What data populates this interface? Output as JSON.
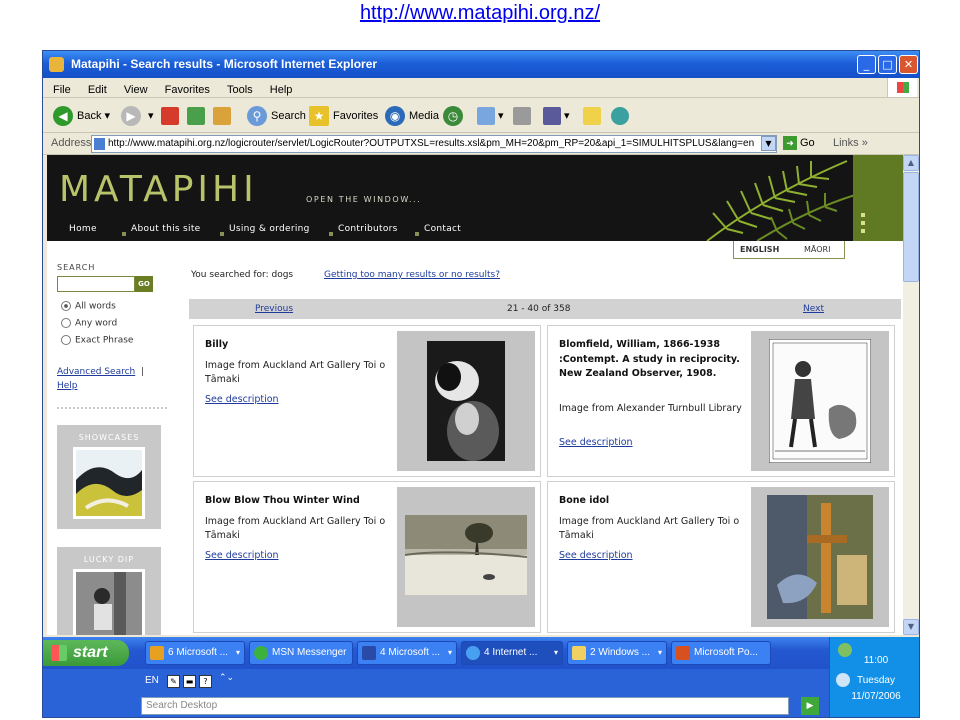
{
  "slide_url": "http://www.matapihi.org.nz/",
  "window": {
    "title": "Matapihi - Search results - Microsoft Internet Explorer",
    "min": "_",
    "max": "□",
    "close": "✕"
  },
  "menu": [
    "File",
    "Edit",
    "View",
    "Favorites",
    "Tools",
    "Help"
  ],
  "toolbar": {
    "back": "Back",
    "search": "Search",
    "favorites": "Favorites",
    "media": "Media"
  },
  "address": {
    "label": "Address",
    "url": "http://www.matapihi.org.nz/logicrouter/servlet/LogicRouter?OUTPUTXSL=results.xsl&pm_MH=20&pm_RP=20&api_1=SIMULHITSPLUS&lang=en",
    "go": "Go",
    "links": "Links"
  },
  "site": {
    "logo": "MATAPIHI",
    "tagline": "OPEN THE WINDOW...",
    "nav": [
      "Home",
      "About this site",
      "Using & ordering",
      "Contributors",
      "Contact"
    ],
    "lang_english": "ENGLISH",
    "lang_maori": "MĀORI"
  },
  "sidebar": {
    "search_label": "SEARCH",
    "go": "GO",
    "options": [
      "All words",
      "Any word",
      "Exact Phrase"
    ],
    "selected_option": "All words",
    "advanced_search": "Advanced Search",
    "separator": "|",
    "help": "Help",
    "showcases": "SHOWCASES",
    "lucky_dip": "LUCKY DIP"
  },
  "results": {
    "you_searched": "You searched for: dogs",
    "too_many": "Getting too many results or no results?",
    "previous": "Previous",
    "range": "21 - 40 of 358",
    "next": "Next",
    "items": [
      {
        "title": "Billy",
        "source": "Image from Auckland Art Gallery Toi o Tāmaki",
        "link": "See description"
      },
      {
        "title": "Blomfield, William, 1866-1938 :Contempt. A study in reciprocity. New Zealand Observer, 1908.",
        "source": "Image from Alexander Turnbull Library",
        "link": "See description"
      },
      {
        "title": "Blow Blow Thou Winter Wind",
        "source": "Image from Auckland Art Gallery Toi o Tāmaki",
        "link": "See description"
      },
      {
        "title": "Bone idol",
        "source": "Image from Auckland Art Gallery Toi o Tāmaki",
        "link": "See description"
      }
    ]
  },
  "taskbar": {
    "start": "start",
    "tasks": [
      "6 Microsoft ...",
      "MSN Messenger",
      "4 Microsoft ...",
      "4 Internet ...",
      "2 Windows ...",
      "Microsoft Po..."
    ],
    "active_task": "4 Internet ...",
    "time": "11:00",
    "day": "Tuesday",
    "date": "11/07/2006",
    "lang": "EN",
    "search_desktop": "Search Desktop"
  }
}
